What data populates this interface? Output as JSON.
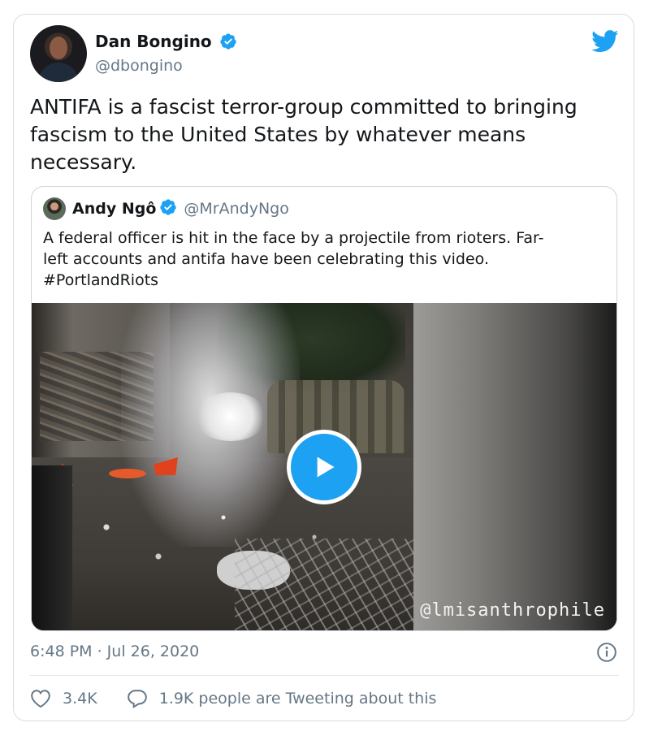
{
  "tweet": {
    "author": {
      "name": "Dan Bongino",
      "handle": "@dbongino",
      "verified": true
    },
    "text": "ANTIFA is a fascist terror-group committed to bringing\nfascism to the United States by whatever means\nnecessary.",
    "timestamp": "6:48 PM · Jul 26, 2020",
    "likes": "3.4K",
    "tweeting_about": "1.9K people are Tweeting about this"
  },
  "quote": {
    "author": {
      "name": "Andy Ngô",
      "handle": "@MrAndyNgo",
      "verified": true
    },
    "text": "A federal officer is hit in the face by a projectile from rioters. Far-\nleft accounts and antifa have been celebrating this video.\n#PortlandRiots",
    "video": {
      "watermark": "@lmisanthrophile",
      "play_icon": "play-icon"
    }
  },
  "icons": {
    "brand": "twitter-bird-icon",
    "verified": "verified-badge-icon",
    "info": "info-icon",
    "like": "heart-icon",
    "reply": "speech-bubble-icon"
  },
  "colors": {
    "twitter_blue": "#1da1f2",
    "text_primary": "#14171a",
    "text_secondary": "#657786",
    "border": "#ccd6dd"
  }
}
